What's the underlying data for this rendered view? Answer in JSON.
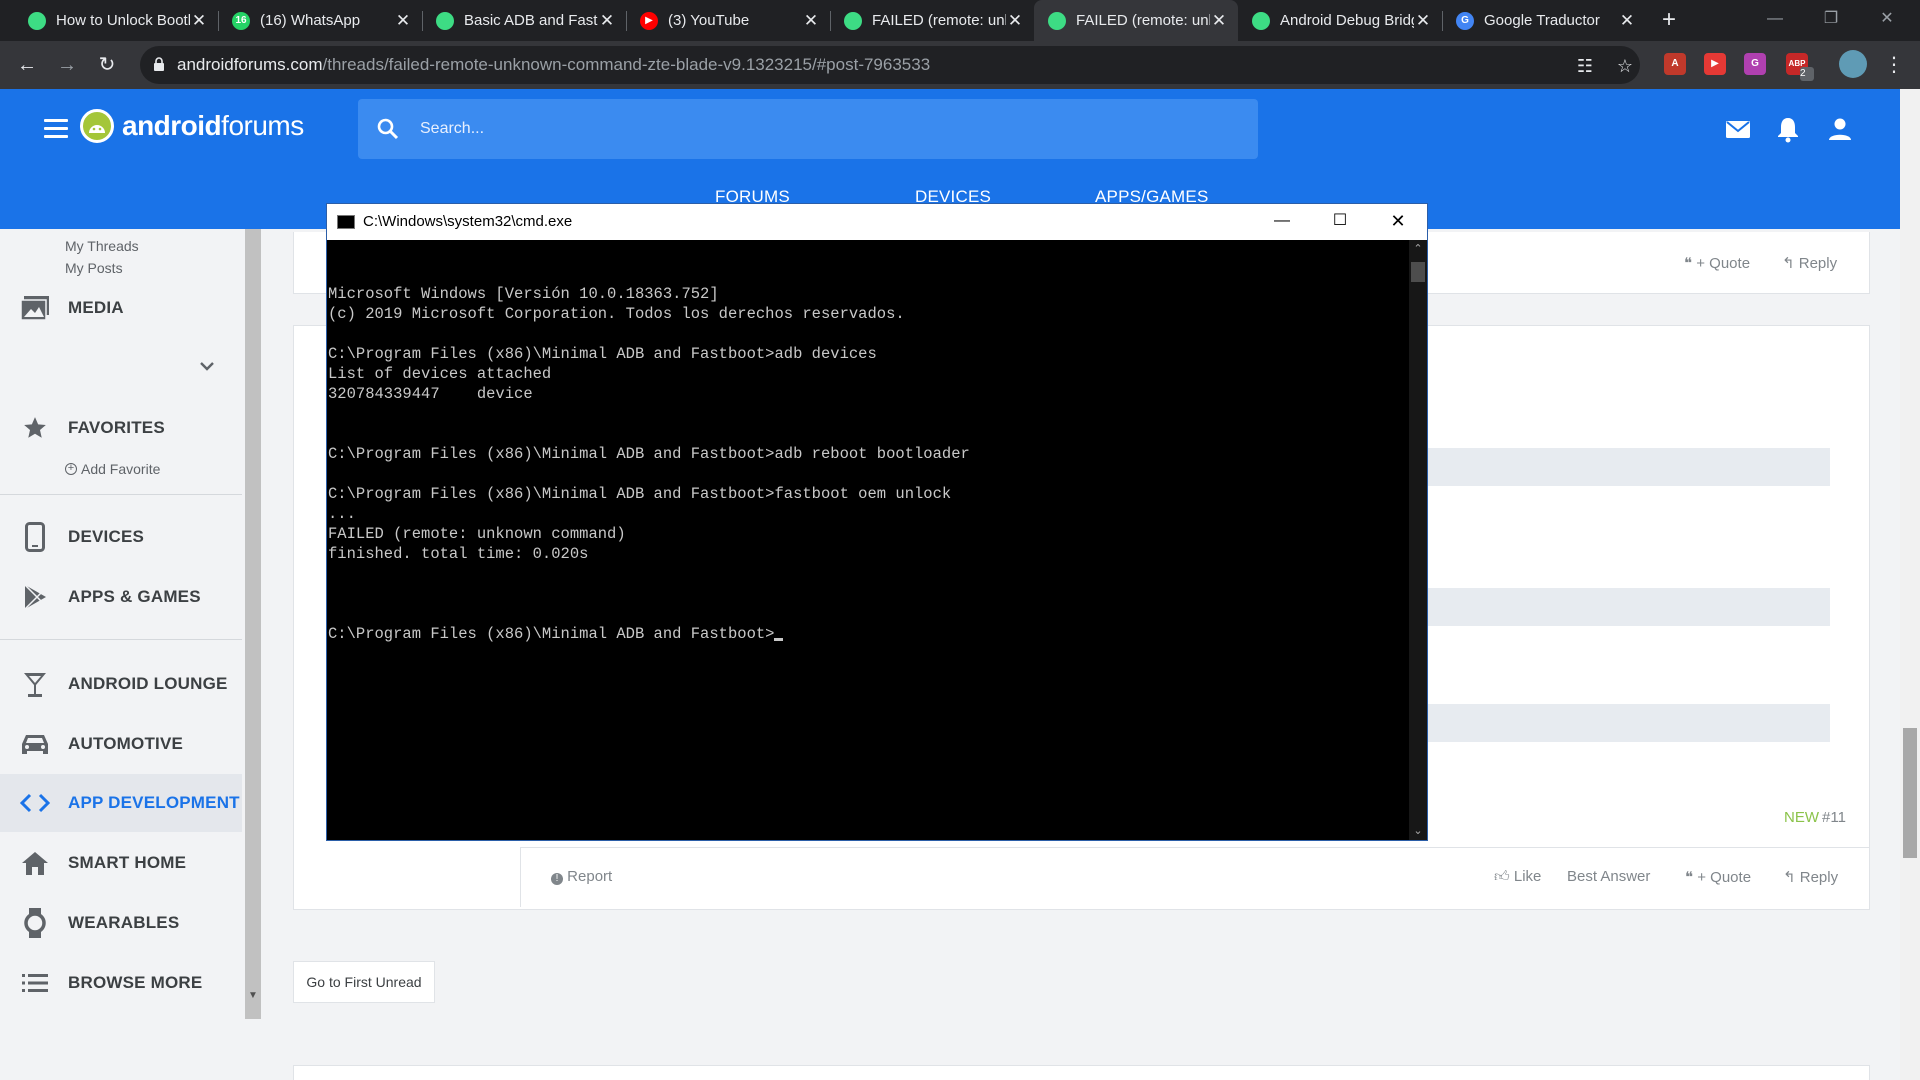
{
  "browser": {
    "tabs": [
      {
        "title": "How to Unlock Bootloader",
        "favicon": "android-forums-favicon",
        "color": "#3ddc84",
        "glyph": ""
      },
      {
        "title": "(16) WhatsApp",
        "favicon": "whatsapp-favicon",
        "color": "#25d366",
        "glyph": "16"
      },
      {
        "title": "Basic ADB and Fastboot",
        "favicon": "android-forums-favicon",
        "color": "#3ddc84",
        "glyph": ""
      },
      {
        "title": "(3) YouTube",
        "favicon": "youtube-favicon",
        "color": "#ff0000",
        "glyph": "▶"
      },
      {
        "title": "FAILED (remote: unknown",
        "favicon": "android-forums-favicon",
        "color": "#3ddc84",
        "glyph": ""
      },
      {
        "title": "FAILED (remote: unknown",
        "favicon": "android-forums-favicon",
        "color": "#3ddc84",
        "glyph": ""
      },
      {
        "title": "Android Debug Bridge",
        "favicon": "android-developers-favicon",
        "color": "#3ddc84",
        "glyph": ""
      },
      {
        "title": "Google Traductor",
        "favicon": "google-translate-favicon",
        "color": "#4285f4",
        "glyph": "G"
      }
    ],
    "active_tab_index": 5,
    "new_tab_label": "+",
    "url": {
      "host": "androidforums.com",
      "path": "/threads/failed-remote-unknown-command-zte-blade-v9.1323215/#post-7963533"
    },
    "extensions": [
      {
        "name": "acrobat-extension",
        "color": "#c0392b",
        "label": "A"
      },
      {
        "name": "screencastify-extension",
        "color": "#e53935",
        "label": "▶"
      },
      {
        "name": "grammarly-extension",
        "color": "#b040b0",
        "label": "G"
      },
      {
        "name": "adblock-extension",
        "color": "#c62828",
        "label": "ABP"
      }
    ],
    "adblock_badge": "2"
  },
  "site": {
    "logo_bold": "android",
    "logo_light": "forums",
    "search_placeholder": "Search...",
    "nav": [
      "FORUMS",
      "DEVICES",
      "APPS/GAMES"
    ]
  },
  "sidebar": {
    "sub_links": [
      "My Threads",
      "My Posts"
    ],
    "media_label": "MEDIA",
    "favorites_label": "FAVORITES",
    "add_favorite": "Add Favorite",
    "items": [
      {
        "label": "DEVICES",
        "icon": "phone-icon"
      },
      {
        "label": "APPS & GAMES",
        "icon": "play-store-icon"
      },
      {
        "label": "ANDROID LOUNGE",
        "icon": "cocktail-icon"
      },
      {
        "label": "AUTOMOTIVE",
        "icon": "car-icon"
      },
      {
        "label": "APP DEVELOPMENT",
        "icon": "code-icon",
        "active": true
      },
      {
        "label": "SMART HOME",
        "icon": "home-icon"
      },
      {
        "label": "WEARABLES",
        "icon": "watch-icon"
      },
      {
        "label": "BROWSE MORE",
        "icon": "list-icon"
      }
    ]
  },
  "post": {
    "top_quote": "+ Quote",
    "top_reply": "Reply",
    "new_label": "NEW",
    "post_number": "#11",
    "report": "Report",
    "like": "Like",
    "best_answer": "Best Answer",
    "quote": "+ Quote",
    "reply": "Reply",
    "go_to_first_unread": "Go to First Unread"
  },
  "cmd": {
    "title": "C:\\Windows\\system32\\cmd.exe",
    "lines": [
      "Microsoft Windows [Versión 10.0.18363.752]",
      "(c) 2019 Microsoft Corporation. Todos los derechos reservados.",
      "",
      "C:\\Program Files (x86)\\Minimal ADB and Fastboot>adb devices",
      "List of devices attached",
      "320784339447    device",
      "",
      "",
      "C:\\Program Files (x86)\\Minimal ADB and Fastboot>adb reboot bootloader",
      "",
      "C:\\Program Files (x86)\\Minimal ADB and Fastboot>fastboot oem unlock",
      "...",
      "FAILED (remote: unknown command)",
      "finished. total time: 0.020s",
      ""
    ],
    "prompt": "C:\\Program Files (x86)\\Minimal ADB and Fastboot>"
  },
  "colors": {
    "brand_blue": "#1a73e8",
    "android_green": "#a4c639",
    "new_green": "#8bc34a"
  }
}
